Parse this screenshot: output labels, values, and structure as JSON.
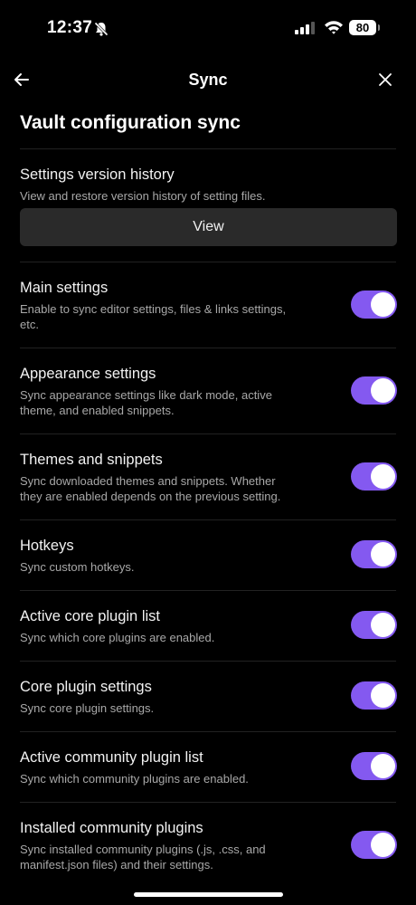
{
  "status_bar": {
    "time": "12:37",
    "battery": "80",
    "icons": [
      "bell-slash-icon",
      "signal-icon",
      "wifi-icon",
      "battery-icon"
    ]
  },
  "nav": {
    "title": "Sync",
    "back_icon": "arrow-left-icon",
    "close_icon": "close-icon"
  },
  "section": {
    "title": "Vault configuration sync"
  },
  "version_history": {
    "title": "Settings version history",
    "description": "View and restore version history of setting files.",
    "button_label": "View"
  },
  "settings": [
    {
      "title": "Main settings",
      "desc1": "Enable to sync editor settings, files & links settings,",
      "desc2": "etc.",
      "enabled": true
    },
    {
      "title": "Appearance settings",
      "desc1": "Sync appearance settings like dark mode, active",
      "desc2": "theme, and enabled snippets.",
      "enabled": true
    },
    {
      "title": "Themes and snippets",
      "desc1": "Sync downloaded themes and snippets. Whether",
      "desc2": "they are enabled depends on the previous setting.",
      "enabled": true
    },
    {
      "title": "Hotkeys",
      "desc1": "Sync custom hotkeys.",
      "desc2": "",
      "enabled": true
    },
    {
      "title": "Active core plugin list",
      "desc1": "Sync which core plugins are enabled.",
      "desc2": "",
      "enabled": true
    },
    {
      "title": "Core plugin settings",
      "desc1": "Sync core plugin settings.",
      "desc2": "",
      "enabled": true
    },
    {
      "title": "Active community plugin list",
      "desc1": "Sync which community plugins are enabled.",
      "desc2": "",
      "enabled": true
    },
    {
      "title": "Installed community plugins",
      "desc1": "Sync installed community plugins (.js, .css, and",
      "desc2": "manifest.json files) and their settings.",
      "enabled": true
    }
  ],
  "colors": {
    "accent": "#8459f0",
    "background": "#000000",
    "button": "#2a2a2a"
  }
}
